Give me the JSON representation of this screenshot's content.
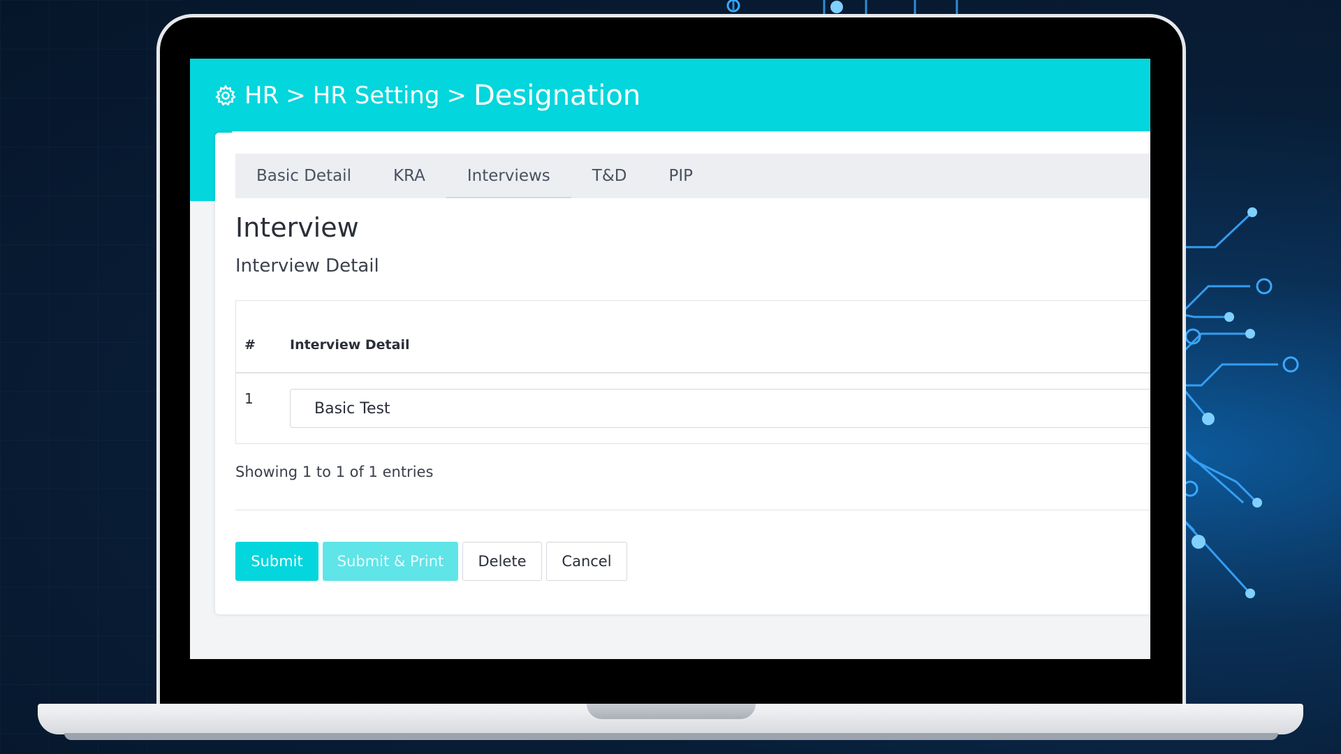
{
  "breadcrumb": {
    "icon": "gear-icon",
    "items": [
      "HR",
      "HR Setting"
    ],
    "separator": ">",
    "current": "Designation"
  },
  "tabs": [
    {
      "label": "Basic Detail",
      "active": false
    },
    {
      "label": "KRA",
      "active": false
    },
    {
      "label": "Interviews",
      "active": true
    },
    {
      "label": "T&D",
      "active": false
    },
    {
      "label": "PIP",
      "active": false
    }
  ],
  "section": {
    "title": "Interview",
    "subtitle": "Interview Detail"
  },
  "table": {
    "headers": [
      "#",
      "Interview Detail"
    ],
    "rows": [
      {
        "index": "1",
        "detail": "Basic Test"
      }
    ]
  },
  "entries_text": "Showing 1 to 1 of 1 entries",
  "actions": {
    "submit": "Submit",
    "submit_print": "Submit & Print",
    "delete": "Delete",
    "cancel": "Cancel"
  },
  "colors": {
    "accent": "#03d6dc",
    "accent_light": "#5fe4e8"
  }
}
